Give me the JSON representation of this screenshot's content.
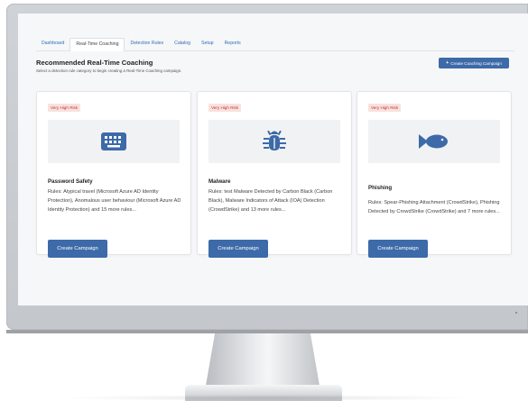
{
  "tabs": [
    {
      "label": "Dashboard"
    },
    {
      "label": "Real-Time Coaching"
    },
    {
      "label": "Detection Rules"
    },
    {
      "label": "Catalog"
    },
    {
      "label": "Setup"
    },
    {
      "label": "Reports"
    }
  ],
  "header": {
    "title": "Recommended Real-Time Coaching",
    "subtitle": "Select a detection rule category to begin creating a Real-Time Coaching campaign.",
    "create_button": "Create Coaching Campaign",
    "create_icon": "plus-icon"
  },
  "cards": [
    {
      "risk": "Very High Risk",
      "icon": "keyboard-icon",
      "title": "Password Safety",
      "rules": "Rules: Atypical travel (Microsoft Azure AD Identity Protection), Anomalous user behaviour (Microsoft Azure AD Identity Protection) and 15 more rules...",
      "button": "Create Campaign"
    },
    {
      "risk": "Very High Risk",
      "icon": "bug-icon",
      "title": "Malware",
      "rules": "Rules: test Malware Detected by Carbon Black (Carbon Black), Malware Indicators of Attack (IOA) Detection (CrowdStrike) and 13 more rules...",
      "button": "Create Campaign"
    },
    {
      "risk": "Very High Risk",
      "icon": "fish-icon",
      "title": "Phishing",
      "rules": "Rules: Spear-Phishing Attachment (CrowdStrike), Phishing Detected by CrowdStrike (CrowdStrike) and 7 more rules...",
      "button": "Create Campaign"
    }
  ],
  "colors": {
    "accent": "#3d6aa8",
    "risk_text": "#c0392b",
    "risk_bg": "#f9e1df",
    "icon": "#3d6aa8"
  }
}
